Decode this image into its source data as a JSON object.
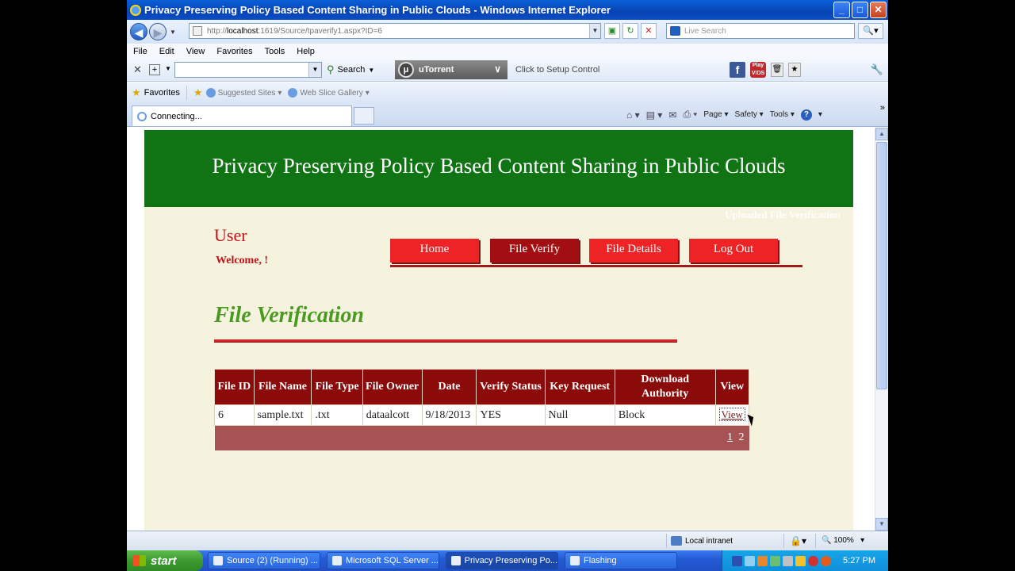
{
  "window": {
    "title": "Privacy Preserving Policy Based Content Sharing in Public Clouds - Windows Internet Explorer",
    "buttons": {
      "minimize": "_",
      "maximize": "□",
      "close": "✕"
    }
  },
  "address_bar": {
    "url_prefix": "http://",
    "url_host": "localhost",
    "url_path": ":1619/Source/tpaverify1.aspx?ID=6",
    "live_search_placeholder": "Live Search"
  },
  "menu": [
    "File",
    "Edit",
    "View",
    "Favorites",
    "Tools",
    "Help"
  ],
  "toolbar": {
    "search_label": "Search",
    "utorrent_label": "uTorrent",
    "setup_label": "Click to Setup Control",
    "play_badge": "Play VIDS"
  },
  "favorites_bar": {
    "favorites_label": "Favorites",
    "items": [
      "Suggested Sites",
      "Web Slice Gallery"
    ]
  },
  "tabs": {
    "active_label": "Connecting..."
  },
  "command_bar": {
    "page": "Page",
    "safety": "Safety",
    "tools": "Tools"
  },
  "page": {
    "banner": "Privacy Preserving Policy Based Content Sharing in Public Clouds",
    "flash_text": "Uploaded File Verification",
    "user_title": "User",
    "welcome": "Welcome,   !",
    "nav": [
      "Home",
      "File Verify",
      "File Details",
      "Log Out"
    ],
    "nav_active": "File Verify",
    "section_title": "File Verification",
    "table": {
      "headers": [
        "File ID",
        "File Name",
        "File Type",
        "File Owner",
        "Date",
        "Verify Status",
        "Key Request",
        "Download Authority",
        "View"
      ],
      "rows": [
        [
          "6",
          "sample.txt",
          ".txt",
          "dataalcott",
          "9/18/2013",
          "YES",
          "Null",
          "Block",
          "View"
        ]
      ],
      "pager": [
        "1",
        "2"
      ],
      "pager_current": "1"
    }
  },
  "status_bar": {
    "zone": "Local intranet",
    "zoom": "100%"
  },
  "taskbar": {
    "start": "start",
    "items": [
      "Source (2) (Running) ...",
      "Microsoft SQL Server ...",
      "Privacy Preserving Po...",
      "Flashing"
    ],
    "active_item": "Privacy Preserving Po...",
    "clock": "5:27 PM"
  },
  "colors": {
    "banner_green": "#107414",
    "nav_red": "#ee2326",
    "nav_active": "#a30e12",
    "table_header": "#8b0b0b",
    "page_bg": "#f5f2dd",
    "section_title": "#4a9a22"
  }
}
